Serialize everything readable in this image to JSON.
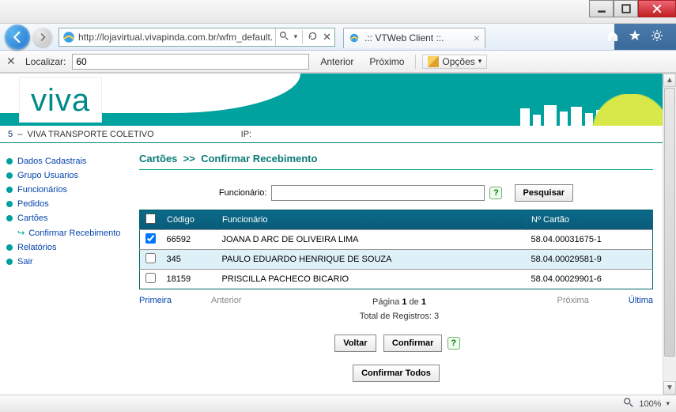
{
  "window": {
    "title": ""
  },
  "nav": {
    "url": "http://lojavirtual.vivapinda.com.br/wfm_default.",
    "tab_title": ".:: VTWeb Client ::."
  },
  "findbar": {
    "label": "Localizar:",
    "value": "60",
    "prev": "Anterior",
    "next": "Próximo",
    "options": "Opções"
  },
  "logo_text": "viva",
  "info": {
    "num": "5",
    "sep": "–",
    "company": "VIVA TRANSPORTE COLETIVO",
    "ip_label": "IP:"
  },
  "sidebar": {
    "items": [
      "Dados Cadastrais",
      "Grupo Usuarios",
      "Funcionários",
      "Pedidos",
      "Cartões"
    ],
    "sub_item": "Confirmar Recebimento",
    "items_after": [
      "Relatórios",
      "Sair"
    ]
  },
  "page": {
    "crumb1": "Cartões",
    "crumb_sep": ">>",
    "crumb2": "Confirmar Recebimento",
    "func_label": "Funcionário:",
    "search_btn": "Pesquisar",
    "columns": {
      "codigo": "Código",
      "func": "Funcionário",
      "cartao": "Nº Cartão"
    },
    "rows": [
      {
        "chk": true,
        "codigo": "66592",
        "func": "JOANA D ARC DE OLIVEIRA LIMA",
        "cartao": "58.04.00031675-1"
      },
      {
        "chk": false,
        "codigo": "345",
        "func": "PAULO EDUARDO HENRIQUE DE SOUZA",
        "cartao": "58.04.00029581-9"
      },
      {
        "chk": false,
        "codigo": "18159",
        "func": "PRISCILLA PACHECO BICARIO",
        "cartao": "58.04.00029901-6"
      }
    ],
    "pager": {
      "first": "Primeira",
      "prev": "Anterior",
      "next": "Próxima",
      "last": "Última",
      "page_line": "Página 1 de 1",
      "total_line": "Total de Registros: 3"
    },
    "actions": {
      "voltar": "Voltar",
      "confirmar": "Confirmar",
      "confirmar_todos": "Confirmar Todos"
    }
  },
  "status": {
    "zoom": "100%"
  }
}
